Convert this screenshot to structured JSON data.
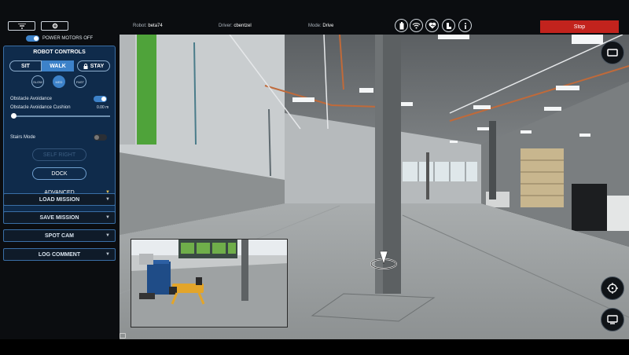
{
  "topbar": {
    "robot_label": "Robot:",
    "robot_value": "beta74",
    "driver_label": "Driver:",
    "driver_value": "cbentzel",
    "mode_label": "Mode:",
    "mode_value": "Drive",
    "stop_label": "Stop",
    "status_icons": [
      "battery-icon",
      "wifi-icon",
      "health-icon",
      "boot-icon",
      "info-icon"
    ],
    "stop_color": "#c2231d"
  },
  "power": {
    "label": "POWER MOTORS OFF"
  },
  "robot_controls": {
    "title": "ROBOT CONTROLS",
    "sit_label": "SIT",
    "walk_label": "WALK",
    "stay_label": "STAY",
    "speed_slow": "SLOW",
    "speed_med": "MED",
    "speed_fast": "FAST",
    "obstacle_avoidance_label": "Obstacle Avoidance",
    "cushion_label": "Obstacle Avoidance Cushion",
    "cushion_value": "0.00 m",
    "stairs_label": "Stairs Mode",
    "self_right_label": "SELF RIGHT",
    "dock_label": "DOCK",
    "advanced_label": "ADVANCED"
  },
  "sections": {
    "load_mission": "LOAD MISSION",
    "save_mission": "SAVE MISSION",
    "spot_cam": "SPOT CAM",
    "log_comment": "LOG COMMENT"
  },
  "colors": {
    "accent": "#3d82c9",
    "panel": "#0f2b4b"
  }
}
